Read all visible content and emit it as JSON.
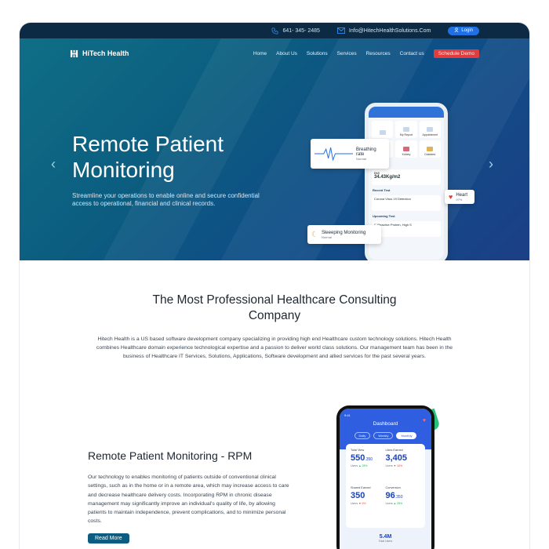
{
  "topbar": {
    "phone": "641- 345- 2485",
    "email": "Info@HitechHealthSolutions.Com",
    "login": "Login"
  },
  "nav": {
    "logo": "HiTech Health",
    "links": [
      "Home",
      "About Us",
      "Solutions",
      "Services",
      "Resources",
      "Contact us"
    ],
    "cta": "Schedule Demo"
  },
  "hero": {
    "title_line1": "Remote Patient",
    "title_line2": "Monitoring",
    "subtitle": "Streamline your operations to enable online and secure confidential access to operational, financial and clinical records.",
    "cards": {
      "breathing": "Breathing rate",
      "breathing_sub": "Normal",
      "heart": "Heart",
      "heart_sub": "97%",
      "sleep": "Sleeeping Monitoring",
      "sleep_sub": "Normal"
    },
    "phone": {
      "tiles": [
        "",
        "My Report",
        "Appointment",
        "Heart",
        "Kidney",
        "Diabetes"
      ],
      "my_health": "My Health",
      "bmi_label": "BMI",
      "bmi_value": "34.43Kg/m2",
      "recent_test": "Recent Test",
      "test1": "Corona Virus 19 Detection",
      "upcoming": "Upcoming Test",
      "test2": "C-Reactive Protein, High S"
    }
  },
  "company": {
    "title_line1": "The Most Professional Healthcare Consulting",
    "title_line2": "Company",
    "text": "Hitech Health is a US based software development company specializing in providing high end  Healthcare custom technology solutions. Hitech Health combines Healthcare domain experience technological expertise and a passion to deliver world class solutions. Our management team has been in the business of Healthcare IT Services, Solutions, Applications, Software development and allied services for the past several years."
  },
  "rpm": {
    "title": "Remote Patient Monitoring - RPM",
    "text": "Our technology to enables monitoring of patients outside of conventional clinical settings, such as in the home or in a remote area, which may increase access to care and decrease healthcare delivery costs. Incorporating RPM in chronic disease management may significantly improve an individual's quality of life, by allowing patients to maintain independence, prevent complications, and to minimize personal costs.",
    "button": "Read More"
  },
  "dashboard": {
    "time": "9:41",
    "title": "Dashboard",
    "tabs": [
      "Daily",
      "Weekly",
      "Monthly"
    ],
    "stats": [
      {
        "label": "Total View",
        "value": "550",
        "small": ".350",
        "meta": "Users",
        "delta": "▲ 28%"
      },
      {
        "label": "Likes Earned",
        "value": "3,405",
        "small": "",
        "meta": "Users",
        "delta": "▼ 16%"
      },
      {
        "label": "Shared Earned",
        "value": "350",
        "small": "",
        "meta": "Users",
        "delta": "▼ 9%"
      },
      {
        "label": "Conversion",
        "value": "96",
        "small": ".350",
        "meta": "Users",
        "delta": "▲ 28%"
      }
    ],
    "footer_value": "5.4M",
    "footer_label": "Total Users"
  }
}
